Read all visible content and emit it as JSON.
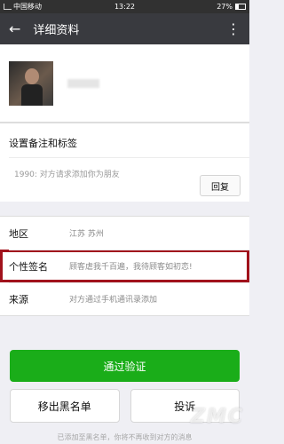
{
  "status_bar": {
    "carrier": "中国移动",
    "time": "13:22",
    "battery": "27%"
  },
  "header": {
    "title": "详细资料",
    "back_icon": "arrow-left-icon",
    "more_icon": "more-vertical-icon"
  },
  "remark_section": {
    "title": "设置备注和标签",
    "request_text": "1990: 对方请求添加你为朋友",
    "reply_label": "回复"
  },
  "info_rows": [
    {
      "label": "地区",
      "value": "江苏  苏州"
    },
    {
      "label": "个性签名",
      "value": "顾客虐我千百遍，我待顾客如初恋!"
    },
    {
      "label": "来源",
      "value": "对方通过手机通讯录添加"
    }
  ],
  "actions": {
    "verify": "通过验证",
    "blacklist": "移出黑名单",
    "complain": "投诉"
  },
  "footer_text": "已添加至黑名单，你将不再收到对方的消息",
  "watermark": "ZMC",
  "colors": {
    "topbar": "#393a3f",
    "accent_green": "#1aad19",
    "highlight_red": "#a1121c"
  }
}
